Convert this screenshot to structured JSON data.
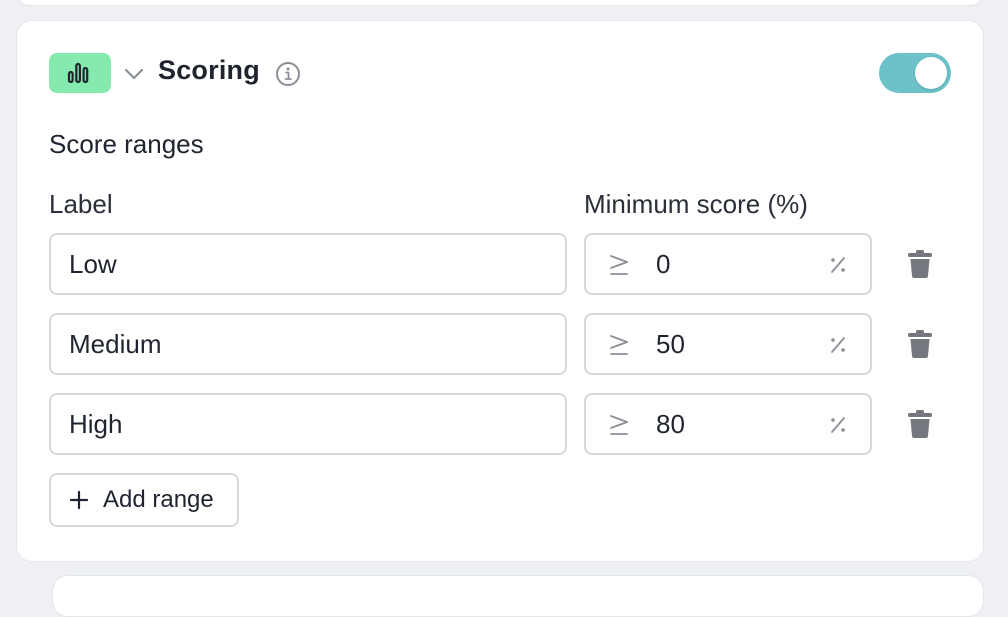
{
  "section": {
    "title": "Scoring",
    "icon": "bar-chart-icon",
    "icon_bg": "#86e9ad",
    "toggle_on": true,
    "toggle_color": "#6cc2c8"
  },
  "score_ranges": {
    "title": "Score ranges",
    "label_header": "Label",
    "min_score_header": "Minimum score (%)",
    "rows": [
      {
        "label": "Low",
        "min_score": "0"
      },
      {
        "label": "Medium",
        "min_score": "50"
      },
      {
        "label": "High",
        "min_score": "80"
      }
    ],
    "add_button_label": "Add range"
  }
}
